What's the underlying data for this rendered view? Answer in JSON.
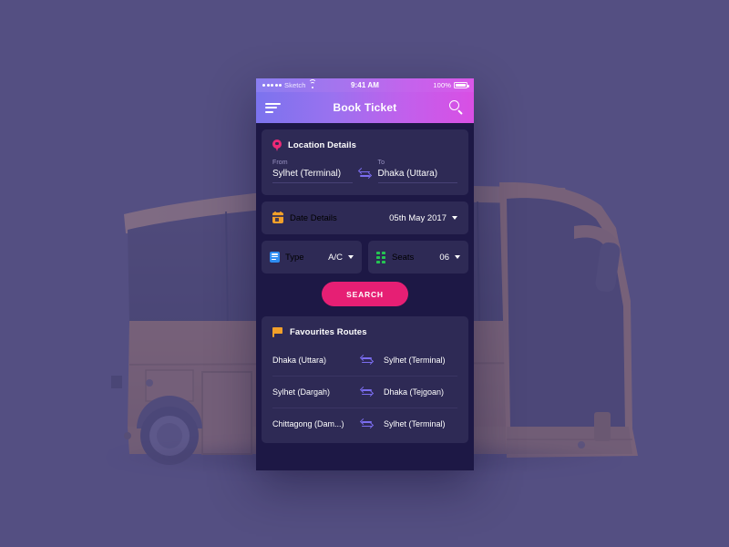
{
  "scene": {
    "background_color": "#544f82",
    "illustration": "bus-illustration"
  },
  "phone": {
    "status_bar": {
      "carrier": "Sketch",
      "wifi_icon": "wifi-icon",
      "time": "9:41 AM",
      "battery_percent": "100%",
      "battery_icon": "battery-full-icon"
    },
    "navbar": {
      "menu_icon": "hamburger-menu-icon",
      "title": "Book Ticket",
      "search_icon": "search-icon",
      "gradient_from": "#7b73ee",
      "gradient_to": "#d94fe4"
    },
    "location_card": {
      "icon": "map-pin-icon",
      "icon_color": "#ec2a77",
      "title": "Location Details",
      "from_label": "From",
      "from_value": "Sylhet (Terminal)",
      "to_label": "To",
      "to_value": "Dhaka (Uttara)",
      "swap_icon": "swap-arrows-icon",
      "swap_color": "#7b6df0"
    },
    "date_card": {
      "icon": "calendar-icon",
      "icon_color": "#f2a02a",
      "title": "Date Details",
      "value": "05th May 2017",
      "caret_icon": "chevron-down-icon"
    },
    "type_card": {
      "icon": "list-icon",
      "icon_color": "#2e8df2",
      "title": "Type",
      "value": "A/C",
      "caret_icon": "chevron-down-icon"
    },
    "seats_card": {
      "icon": "grid-icon",
      "icon_color": "#25c552",
      "title": "Seats",
      "value": "06",
      "caret_icon": "chevron-down-icon"
    },
    "search_button": {
      "label": "SEARCH",
      "color": "#e61f74"
    },
    "favourites_card": {
      "icon": "flag-icon",
      "icon_color": "#f2a02a",
      "title": "Favourites Routes",
      "routes": [
        {
          "from": "Dhaka (Uttara)",
          "to": "Sylhet (Terminal)",
          "swap_icon": "swap-arrows-icon"
        },
        {
          "from": "Sylhet (Dargah)",
          "to": "Dhaka (Tejgoan)",
          "swap_icon": "swap-arrows-icon"
        },
        {
          "from": "Chittagong (Dam...)",
          "to": "Sylhet (Terminal)",
          "swap_icon": "swap-arrows-icon"
        }
      ]
    }
  }
}
